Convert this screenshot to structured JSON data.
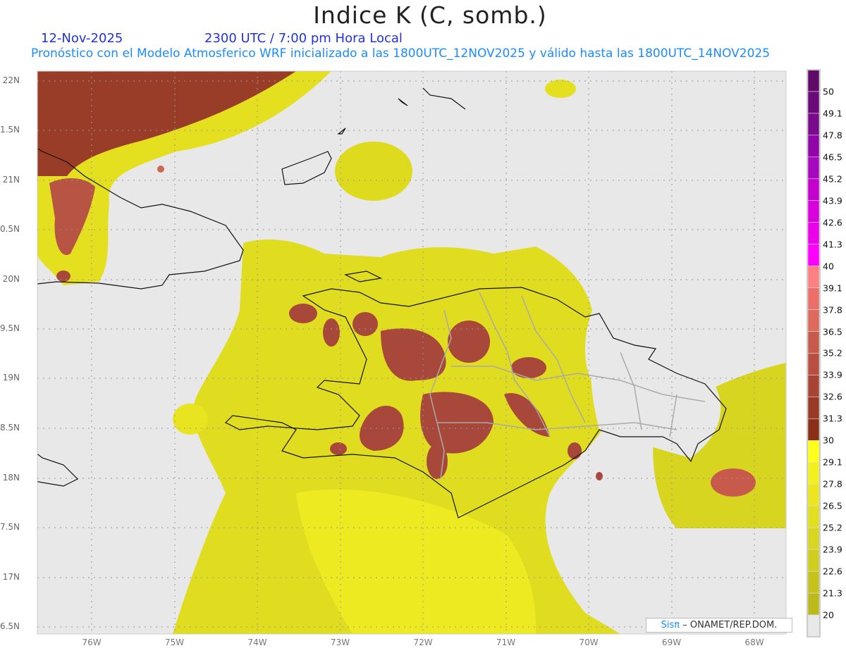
{
  "header": {
    "title": "Indice K (C, somb.)",
    "date": "12-Nov-2025",
    "time": "2300 UTC / 7:00 pm Hora Local",
    "subtitle": "Pronóstico con el Modelo Atmosferico WRF inicializado a las 1800UTC_12NOV2025 y válido hasta las  1800UTC_14NOV2025"
  },
  "axes": {
    "lat_labels": [
      "22N",
      "1.5N",
      "21N",
      "0.5N",
      "20N",
      "9.5N",
      "19N",
      "8.5N",
      "18N",
      "7.5N",
      "17N",
      "6.5N"
    ],
    "lon_labels": [
      "76W",
      "75W",
      "74W",
      "73W",
      "72W",
      "71W",
      "70W",
      "69W",
      "68W"
    ]
  },
  "colorbar": {
    "labels": [
      "50",
      "49.1",
      "47.8",
      "46.5",
      "45.2",
      "43.9",
      "42.6",
      "41.3",
      "40",
      "39.1",
      "37.8",
      "36.5",
      "35.2",
      "33.9",
      "32.6",
      "31.3",
      "30",
      "29.1",
      "27.8",
      "26.5",
      "25.2",
      "23.9",
      "22.6",
      "21.3",
      "20"
    ],
    "colors": [
      "#5e0a66",
      "#6a0a78",
      "#7a0a8c",
      "#9005a8",
      "#a808bd",
      "#c400cf",
      "#d900de",
      "#eb00ea",
      "#ff00ff",
      "#ff8080",
      "#ec6e68",
      "#dd6a5c",
      "#c85a4c",
      "#b84f42",
      "#a84433",
      "#983a25",
      "#8a3018",
      "#ffff1e",
      "#f3f020",
      "#ebe61f",
      "#e2df1e",
      "#d8d620",
      "#d0cd1e",
      "#c5c21c",
      "#bcba1a",
      "#e8e8e8"
    ]
  },
  "footer": {
    "brand": "Sisπ",
    "org": "– ONAMET/REP.DOM."
  }
}
